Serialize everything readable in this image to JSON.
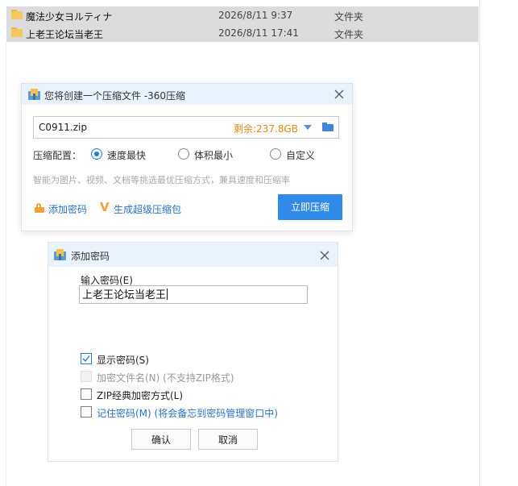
{
  "explorer": {
    "rows": [
      {
        "name": "魔法少女ヨルティナ",
        "date": "2026/8/11 9:37",
        "type": "文件夹"
      },
      {
        "name": "上老王论坛当老王",
        "date": "2026/8/11 17:41",
        "type": "文件夹"
      }
    ]
  },
  "compress_dialog": {
    "title": "您将创建一个压缩文件 -360压缩",
    "filename": "C0911.zip",
    "remaining": "剩余:237.8GB",
    "config_label": "压缩配置：",
    "options": [
      {
        "label": "速度最快",
        "selected": true
      },
      {
        "label": "体积最小",
        "selected": false
      },
      {
        "label": "自定义",
        "selected": false
      }
    ],
    "hint": "智能为图片、视频、文档等挑选最优压缩方式，兼具速度和压缩率",
    "add_password_link": "添加密码",
    "super_pack_link": "生成超级压缩包",
    "v_icon": "V",
    "compress_button": "立即压缩"
  },
  "password_dialog": {
    "title": "添加密码",
    "input_label": "输入密码(E)",
    "password_value": "上老王论坛当老王",
    "show_password": {
      "label": "显示密码(S)",
      "checked": true
    },
    "encrypt_filenames": {
      "label": "加密文件名(N) (不支持ZIP格式)",
      "checked": false,
      "disabled": true
    },
    "zip_classic": {
      "label": "ZIP经典加密方式(L)",
      "checked": false
    },
    "remember": {
      "label": "记住密码(M) (将会备忘到密码管理窗口中)",
      "checked": false
    },
    "ok_button": "确认",
    "cancel_button": "取消"
  },
  "colors": {
    "accent": "#2f8ae8",
    "remaining": "#e08a16",
    "link": "#2a72c5",
    "title_bar": "#e9f3fd"
  }
}
